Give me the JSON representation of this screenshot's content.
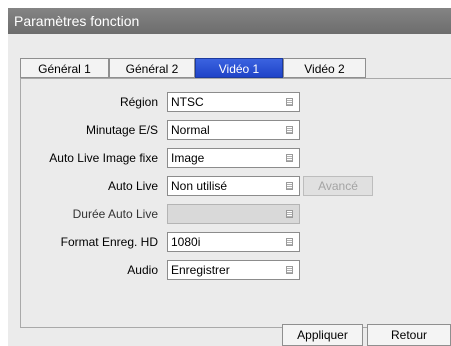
{
  "window": {
    "title": "Paramètres fonction"
  },
  "tabs": [
    {
      "label": "Général 1",
      "active": false
    },
    {
      "label": "Général 2",
      "active": false
    },
    {
      "label": "Vidéo 1",
      "active": true
    },
    {
      "label": "Vidéo 2",
      "active": false
    }
  ],
  "settings": {
    "region": {
      "label": "Région",
      "value": "NTSC"
    },
    "timer_io": {
      "label": "Minutage E/S",
      "value": "Normal"
    },
    "auto_live_still": {
      "label": "Auto Live Image fixe",
      "value": "Image"
    },
    "auto_live": {
      "label": "Auto Live",
      "value": "Non utilisé",
      "advanced_label": "Avancé"
    },
    "auto_live_duration": {
      "label": "Durée Auto Live",
      "value": ""
    },
    "hd_record_format": {
      "label": "Format Enreg. HD",
      "value": "1080i"
    },
    "audio": {
      "label": "Audio",
      "value": "Enregistrer"
    }
  },
  "footer": {
    "apply_label": "Appliquer",
    "back_label": "Retour"
  },
  "colors": {
    "title_bar": "#777777",
    "active_tab": "#2a4fd6",
    "panel_bg": "#ebebeb"
  }
}
